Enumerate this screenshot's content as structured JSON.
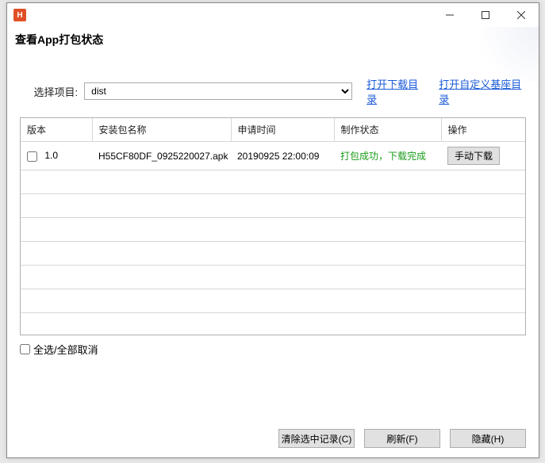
{
  "window": {
    "app_icon_letter": "H",
    "title": "查看App打包状态"
  },
  "project": {
    "label": "选择项目:",
    "selected": "dist",
    "link_download_dir": "打开下载目录",
    "link_custom_base_dir": "打开自定义基座目录"
  },
  "table": {
    "headers": {
      "version": "版本",
      "package": "安装包名称",
      "time": "申请时间",
      "status": "制作状态",
      "action": "操作"
    },
    "rows": [
      {
        "version": "1.0",
        "package": "H55CF80DF_0925220027.apk",
        "time": "20190925 22:00:09",
        "status": "打包成功，下载完成",
        "action_label": "手动下载"
      }
    ]
  },
  "select_all": {
    "label": "全选/全部取消"
  },
  "footer": {
    "clear": "清除选中记录(C)",
    "refresh": "刷新(F)",
    "hide": "隐藏(H)"
  }
}
